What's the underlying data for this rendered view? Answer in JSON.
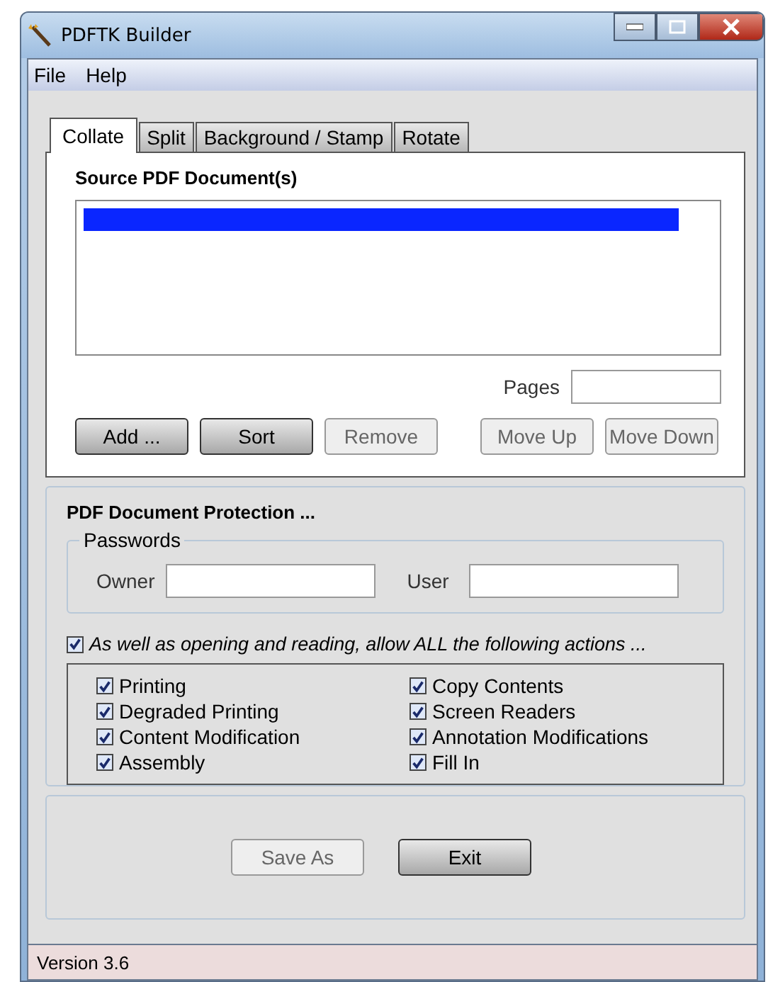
{
  "window": {
    "title": "PDFTK Builder"
  },
  "menu": [
    "File",
    "Help"
  ],
  "tabs": [
    {
      "label": "Collate",
      "selected": true
    },
    {
      "label": "Split",
      "selected": false
    },
    {
      "label": "Background / Stamp",
      "selected": false
    },
    {
      "label": "Rotate",
      "selected": false
    }
  ],
  "source": {
    "title": "Source PDF Document(s)",
    "rows": [
      {
        "selected": true
      }
    ],
    "pages_label": "Pages",
    "buttons": [
      {
        "label": "Add ...",
        "disabled": false
      },
      {
        "label": "Sort",
        "disabled": false
      },
      {
        "label": "Remove",
        "disabled": true
      },
      {
        "label": "Move Up",
        "disabled": true
      },
      {
        "label": "Move Down",
        "disabled": true
      }
    ]
  },
  "protection": {
    "title": "PDF Document Protection ...",
    "passwords_title": "Passwords",
    "owner_label": "Owner",
    "user_label": "User",
    "allow": {
      "label": "As well as opening and reading, allow ALL the following actions ...",
      "checked": true
    },
    "permissions": [
      {
        "label": "Printing",
        "checked": true
      },
      {
        "label": "Degraded Printing",
        "checked": true
      },
      {
        "label": "Content Modification",
        "checked": true
      },
      {
        "label": "Assembly",
        "checked": true
      },
      {
        "label": "Copy Contents",
        "checked": true
      },
      {
        "label": "Screen Readers",
        "checked": true
      },
      {
        "label": "Annotation Modifications",
        "checked": true
      },
      {
        "label": "Fill In",
        "checked": true
      }
    ]
  },
  "actions": [
    {
      "label": "Save As",
      "disabled": true
    },
    {
      "label": "Exit",
      "disabled": false
    }
  ],
  "status_bar": "Version 3.6"
}
